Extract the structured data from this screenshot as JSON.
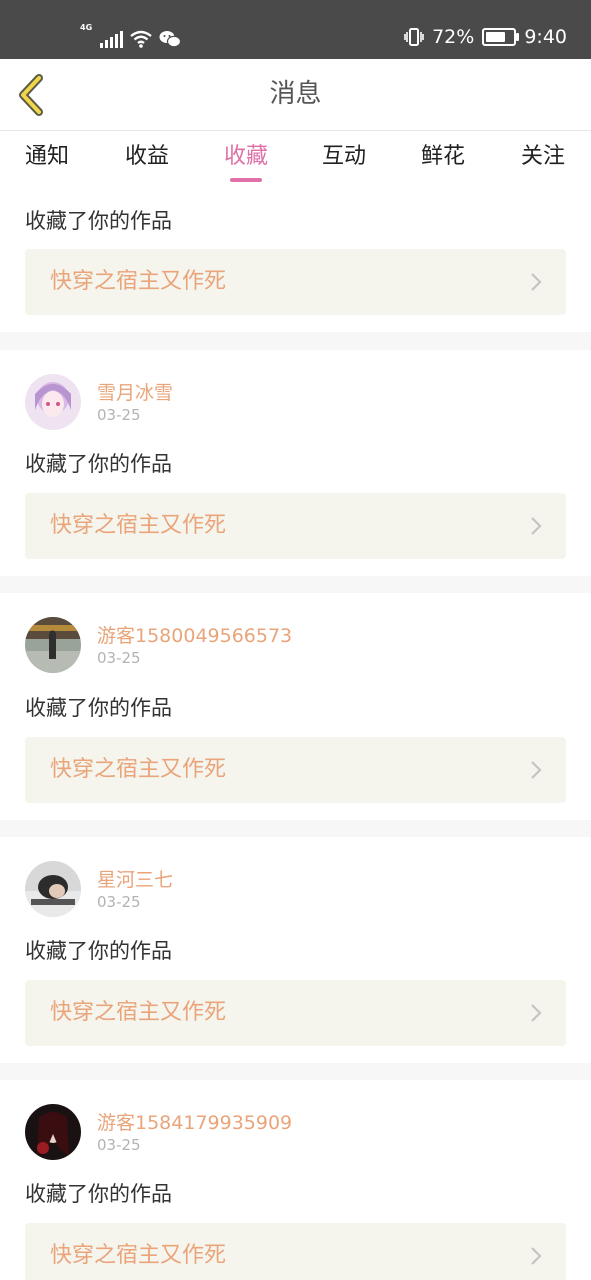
{
  "status_bar": {
    "network": "4G",
    "battery": "72%",
    "battery_level": 0.72,
    "time": "9:40",
    "icons": [
      "signal-icon",
      "wifi-icon",
      "wechat-icon",
      "vibrate-icon",
      "battery-icon"
    ]
  },
  "header": {
    "title": "消息",
    "back_icon": "chevron-left-icon"
  },
  "tabs": [
    {
      "label": "通知",
      "active": false
    },
    {
      "label": "收益",
      "active": false
    },
    {
      "label": "收藏",
      "active": true
    },
    {
      "label": "互动",
      "active": false
    },
    {
      "label": "鲜花",
      "active": false
    },
    {
      "label": "关注",
      "active": false
    }
  ],
  "colors": {
    "accent": "#e071a8",
    "username": "#e9a47a",
    "work_bg": "#f5f5ee"
  },
  "notifications": [
    {
      "username": "",
      "date": "",
      "action": "收藏了你的作品",
      "work_title": "快穿之宿主又作死"
    },
    {
      "username": "雪月冰雪",
      "date": "03-25",
      "action": "收藏了你的作品",
      "work_title": "快穿之宿主又作死"
    },
    {
      "username": "游客1580049566573",
      "date": "03-25",
      "action": "收藏了你的作品",
      "work_title": "快穿之宿主又作死"
    },
    {
      "username": "星河三七",
      "date": "03-25",
      "action": "收藏了你的作品",
      "work_title": "快穿之宿主又作死"
    },
    {
      "username": "游客1584179935909",
      "date": "03-25",
      "action": "收藏了你的作品",
      "work_title": "快穿之宿主又作死"
    }
  ]
}
